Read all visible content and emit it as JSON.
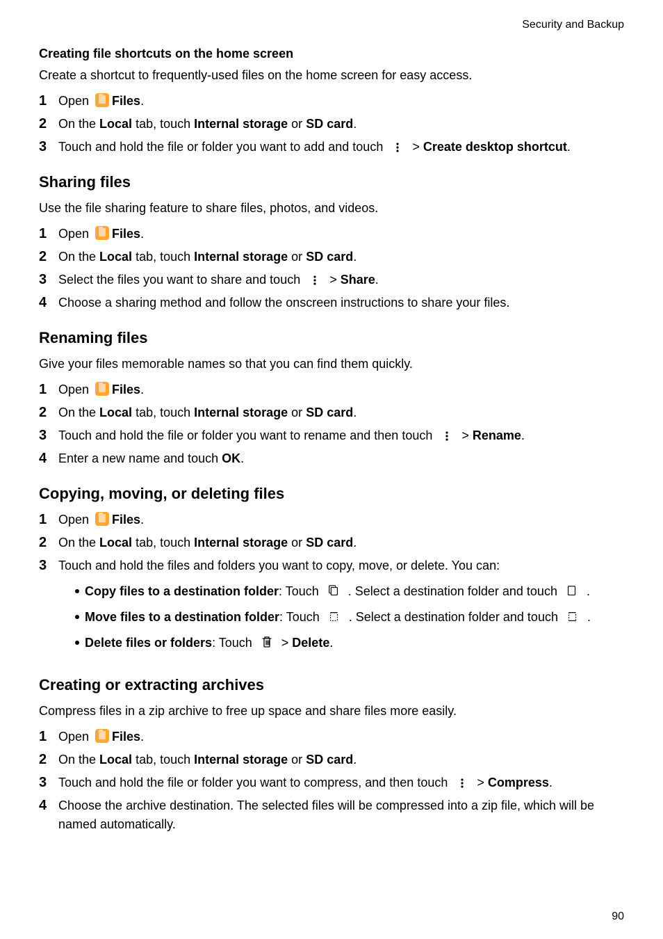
{
  "icons": {
    "more_vert": "more-vert-icon",
    "copy": "copy-icon",
    "paste": "paste-icon",
    "move": "move-icon",
    "move_target": "move-target-icon",
    "trash": "trash-icon"
  },
  "header": {
    "section": "Security and Backup",
    "page_number": "90"
  },
  "s1": {
    "title": "Creating file shortcuts on the home screen",
    "intro": "Create a shortcut to frequently-used files on the home screen for easy access.",
    "step1_a": "Open ",
    "step1_b": "Files",
    "step1_c": ".",
    "step2_a": "On the ",
    "step2_b": "Local",
    "step2_c": " tab, touch ",
    "step2_d": "Internal storage",
    "step2_e": " or ",
    "step2_f": "SD card",
    "step2_g": ".",
    "step3_a": "Touch and hold the file or folder you want to add and touch ",
    "step3_gt": " > ",
    "step3_b": "Create desktop shortcut",
    "step3_c": "."
  },
  "s2": {
    "title": "Sharing files",
    "intro": "Use the file sharing feature to share files, photos, and videos.",
    "step1_a": "Open ",
    "step1_b": "Files",
    "step1_c": ".",
    "step2_a": "On the ",
    "step2_b": "Local",
    "step2_c": " tab, touch ",
    "step2_d": "Internal storage",
    "step2_e": " or ",
    "step2_f": "SD card",
    "step2_g": ".",
    "step3_a": "Select the files you want to share and touch ",
    "step3_gt": " > ",
    "step3_b": "Share",
    "step3_c": ".",
    "step4": "Choose a sharing method and follow the onscreen instructions to share your files."
  },
  "s3": {
    "title": "Renaming files",
    "intro": "Give your files memorable names so that you can find them quickly.",
    "step1_a": "Open ",
    "step1_b": "Files",
    "step1_c": ".",
    "step2_a": "On the ",
    "step2_b": "Local",
    "step2_c": " tab, touch ",
    "step2_d": "Internal storage",
    "step2_e": " or ",
    "step2_f": "SD card",
    "step2_g": ".",
    "step3_a": "Touch and hold the file or folder you want to rename and then touch ",
    "step3_gt": " > ",
    "step3_b": "Rename",
    "step3_c": ".",
    "step4_a": "Enter a new name and touch ",
    "step4_b": "OK",
    "step4_c": "."
  },
  "s4": {
    "title": "Copying, moving, or deleting files",
    "step1_a": "Open ",
    "step1_b": "Files",
    "step1_c": ".",
    "step2_a": "On the ",
    "step2_b": "Local",
    "step2_c": " tab, touch ",
    "step2_d": "Internal storage",
    "step2_e": " or ",
    "step2_f": "SD card",
    "step2_g": ".",
    "step3_a": "Touch and hold the files and folders you want to copy, move, or delete. You can:",
    "b1_a": "Copy files to a destination folder",
    "b1_b": ": Touch ",
    "b1_c": " . Select a destination folder and touch ",
    "b1_d": " .",
    "b2_a": "Move files to a destination folder",
    "b2_b": ": Touch ",
    "b2_c": " . Select a destination folder and touch ",
    "b2_d": " .",
    "b3_a": "Delete files or folders",
    "b3_b": ": Touch ",
    "b3_gt": " > ",
    "b3_c": "Delete",
    "b3_d": "."
  },
  "s5": {
    "title": "Creating or extracting archives",
    "intro": "Compress files in a zip archive to free up space and share files more easily.",
    "step1_a": "Open ",
    "step1_b": "Files",
    "step1_c": ".",
    "step2_a": "On the ",
    "step2_b": "Local",
    "step2_c": " tab, touch ",
    "step2_d": "Internal storage",
    "step2_e": " or ",
    "step2_f": "SD card",
    "step2_g": ".",
    "step3_a": "Touch and hold the file or folder you want to compress, and then touch ",
    "step3_gt": " > ",
    "step3_b": "Compress",
    "step3_c": ".",
    "step4": "Choose the archive destination. The selected files will be compressed into a zip file, which will be named automatically."
  },
  "nums": {
    "n1": "1",
    "n2": "2",
    "n3": "3",
    "n4": "4"
  }
}
